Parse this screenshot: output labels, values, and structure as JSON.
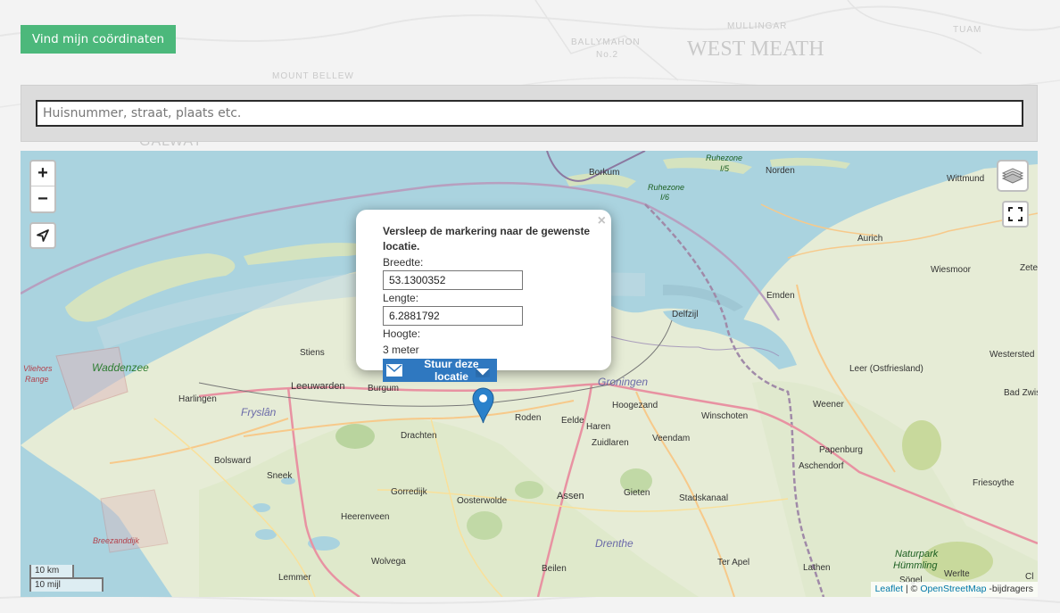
{
  "find_button": {
    "label": "Vind mijn coördinaten"
  },
  "search": {
    "placeholder": "Huisnummer, straat, plaats etc."
  },
  "background_labels": [
    "BALLYMAHON",
    "No.2",
    "MULLINGAR",
    "WEST MEATH",
    "MOUNT BELLEW",
    "GALWAY",
    "TUAM"
  ],
  "map": {
    "controls": {
      "zoom_in": "+",
      "zoom_out": "−"
    },
    "popup": {
      "close": "×",
      "title": "Versleep de markering naar de gewenste locatie.",
      "latitude_label": "Breedte:",
      "latitude_value": "53.1300352",
      "longitude_label": "Lengte:",
      "longitude_value": "6.2881792",
      "altitude_label": "Hoogte:",
      "altitude_value": "3 meter",
      "send_label": "Stuur deze locatie"
    },
    "places": {
      "borkum": "Borkum",
      "norden": "Norden",
      "wittmund": "Wittmund",
      "aurich": "Aurich",
      "wiesmoor": "Wiesmoor",
      "emden": "Emden",
      "delfzijl": "Delfzijl",
      "zete": "Zete",
      "westerstede": "Westersted",
      "leer": "Leer (Ostfriesland)",
      "badzw": "Bad Zwis",
      "weener": "Weener",
      "winschoten": "Winschoten",
      "hoogezand": "Hoogezand",
      "haren": "Haren",
      "eelde": "Eelde",
      "roden": "Roden",
      "zuidlaren": "Zuidlaren",
      "veendam": "Veendam",
      "papenburg": "Papenburg",
      "aschendorf": "Aschendorf",
      "friesoythe": "Friesoythe",
      "stadskanaal": "Stadskanaal",
      "gieten": "Gieten",
      "assen": "Assen",
      "terapel": "Ter Apel",
      "lathen": "Lathen",
      "sogel": "Sögel",
      "werlte": "Werlte",
      "beilen": "Beilen",
      "oosterwolde": "Oosterwolde",
      "wolvega": "Wolvega",
      "heerenveen": "Heerenveen",
      "gorredijk": "Gorredijk",
      "drachten": "Drachten",
      "burgum": "Burgum",
      "leeuwarden": "Leeuwarden",
      "stiens": "Stiens",
      "harlingen": "Harlingen",
      "bolsward": "Bolsward",
      "sneek": "Sneek",
      "lemmer": "Lemmer",
      "cl": "Cl"
    },
    "regions": {
      "waddenzee": "Waddenzee",
      "fryslan": "Fryslân",
      "groningen": "Groningen",
      "drenthe": "Drenthe",
      "naturpark": "Naturpark",
      "humming": "Hümmling",
      "ruhezone15": "Ruhezone",
      "ruhezone15n": "I/5",
      "ruhezone16": "Ruhezone",
      "ruhezone16n": "I/6",
      "vliehors": "Vliehors",
      "range": "Range",
      "breezanddijk": "Breezanddijk"
    },
    "scale": {
      "km": "10 km",
      "mi": "10 mijl"
    },
    "attribution": {
      "leaflet": "Leaflet",
      "sep": " | © ",
      "osm": "OpenStreetMap",
      "suffix": " -bijdragers"
    }
  }
}
